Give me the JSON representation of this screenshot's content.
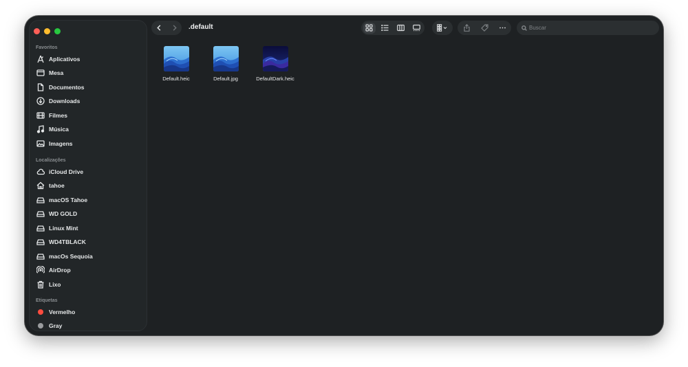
{
  "window": {
    "title": ".default"
  },
  "sidebar": {
    "favorites_label": "Favoritos",
    "favorites": [
      {
        "label": "Aplicativos",
        "icon": "apps-icon"
      },
      {
        "label": "Mesa",
        "icon": "desktop-icon"
      },
      {
        "label": "Documentos",
        "icon": "document-icon"
      },
      {
        "label": "Downloads",
        "icon": "download-icon"
      },
      {
        "label": "Filmes",
        "icon": "film-icon"
      },
      {
        "label": "Música",
        "icon": "music-icon"
      },
      {
        "label": "Imagens",
        "icon": "photo-icon"
      }
    ],
    "locations_label": "Localizações",
    "locations": [
      {
        "label": "iCloud Drive",
        "icon": "cloud-icon"
      },
      {
        "label": "tahoe",
        "icon": "home-icon"
      },
      {
        "label": "macOS Tahoe",
        "icon": "drive-icon"
      },
      {
        "label": "WD GOLD",
        "icon": "drive-icon"
      },
      {
        "label": "Linux Mint",
        "icon": "drive-icon"
      },
      {
        "label": "WD4TBLACK",
        "icon": "drive-icon"
      },
      {
        "label": "macOs Sequoia",
        "icon": "drive-icon"
      },
      {
        "label": "AirDrop",
        "icon": "airdrop-icon"
      },
      {
        "label": "Lixo",
        "icon": "trash-icon"
      }
    ],
    "tags_label": "Etiquetas",
    "tags": [
      {
        "label": "Vermelho",
        "color": "#fe4c3f"
      },
      {
        "label": "Gray",
        "color": "#9a9c9e"
      }
    ]
  },
  "search": {
    "placeholder": "Buscar",
    "value": ""
  },
  "files": [
    {
      "name": "Default.heic",
      "variant": "light"
    },
    {
      "name": "Default.jpg",
      "variant": "light"
    },
    {
      "name": "DefaultDark.heic",
      "variant": "dark"
    }
  ],
  "colors": {
    "window_bg": "#1e2123",
    "sidebar_bg": "#222628",
    "text": "#e6e8e9",
    "muted": "#8a8e91"
  }
}
